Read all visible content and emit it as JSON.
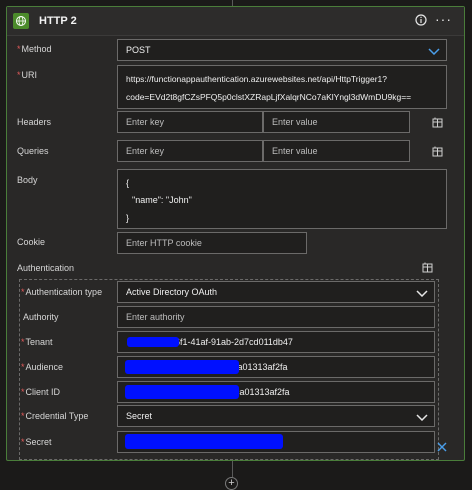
{
  "card": {
    "title": "HTTP 2",
    "icon": "globe-icon",
    "info_icon": "info-icon",
    "more_label": "···"
  },
  "method": {
    "label": "Method",
    "value": "POST"
  },
  "uri": {
    "label": "URI",
    "line1": "https://functionappauthentication.azurewebsites.net/api/HttpTrigger1?",
    "line2": "code=EVd2t8gfCZsPFQ5p0clstXZRapLjfXalqrNCo7aKlYngl3dWmDU9kg=="
  },
  "headers": {
    "label": "Headers",
    "key_placeholder": "Enter key",
    "value_placeholder": "Enter value"
  },
  "queries": {
    "label": "Queries",
    "key_placeholder": "Enter key",
    "value_placeholder": "Enter value"
  },
  "body": {
    "label": "Body",
    "line1": "{",
    "line2": "\"name\": \"John\"",
    "line3": "}"
  },
  "cookie": {
    "label": "Cookie",
    "placeholder": "Enter HTTP cookie"
  },
  "authentication": {
    "label": "Authentication",
    "type_label": "Authentication type",
    "type_value": "Active Directory OAuth",
    "authority_label": "Authority",
    "authority_placeholder": "Enter authority",
    "tenant_label": "Tenant",
    "tenant_value": "86f1-41af-91ab-2d7cd011db47",
    "audience_label": "Audience",
    "audience_value": "ca01313af2fa",
    "client_id_label": "Client ID",
    "client_id_value": "-ca01313af2fa",
    "credential_type_label": "Credential Type",
    "credential_type_value": "Secret",
    "secret_label": "Secret"
  },
  "colors": {
    "accent": "#4c8b2b",
    "required": "#e05a5a",
    "chevron": "#4a9eea",
    "redaction": "#0010ff"
  }
}
